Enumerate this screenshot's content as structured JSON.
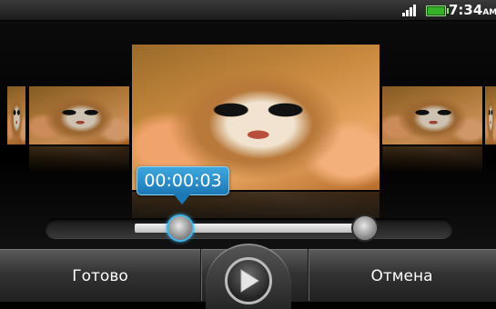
{
  "status_bar": {
    "time": "7:34",
    "ampm": "AM",
    "signal_icon": "signal-bars-icon",
    "battery_icon": "battery-icon",
    "battery_color": "#35b22a"
  },
  "editor": {
    "current_time": "00:00:03",
    "trim_start_fraction": 0.33,
    "trim_end_fraction": 0.79
  },
  "bottom_bar": {
    "done_label": "Готово",
    "cancel_label": "Отмена",
    "play_icon": "play-icon"
  },
  "colors": {
    "accent": "#2a8fd0"
  }
}
